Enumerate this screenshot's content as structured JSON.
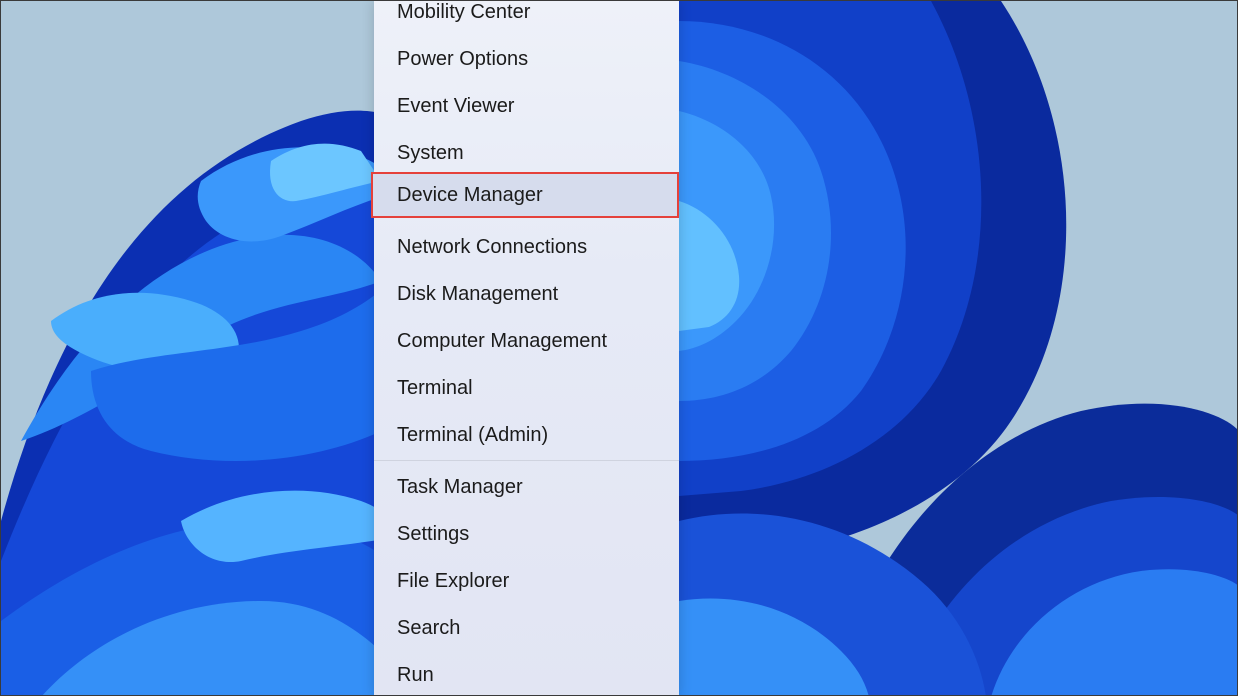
{
  "context_menu": {
    "items": [
      {
        "label": "Mobility Center"
      },
      {
        "label": "Power Options"
      },
      {
        "label": "Event Viewer"
      },
      {
        "label": "System"
      },
      {
        "label": "Device Manager",
        "highlighted": true
      },
      {
        "label": "Network Connections"
      },
      {
        "label": "Disk Management"
      },
      {
        "label": "Computer Management"
      },
      {
        "label": "Terminal"
      },
      {
        "label": "Terminal (Admin)"
      },
      {
        "label": "Task Manager"
      },
      {
        "label": "Settings"
      },
      {
        "label": "File Explorer"
      },
      {
        "label": "Search"
      },
      {
        "label": "Run"
      }
    ],
    "highlight_color": "#e5413b"
  },
  "wallpaper": {
    "name": "bloom-wallpaper",
    "background_color": "#aec8da",
    "petal_colors": [
      "#0a33b8",
      "#1556e0",
      "#2f86f5",
      "#5ab8ff"
    ]
  }
}
